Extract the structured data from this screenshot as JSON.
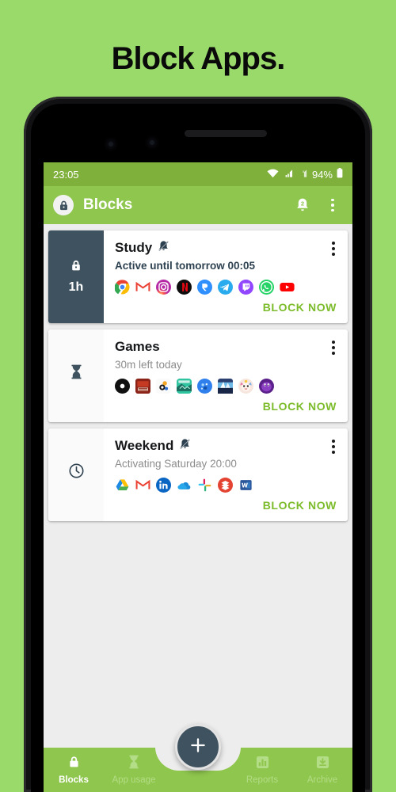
{
  "headline": "Block Apps.",
  "status_bar": {
    "time": "23:05",
    "battery": "94%",
    "icons": [
      "wifi-icon",
      "signal-icon",
      "signal-no-sim-icon",
      "battery-icon"
    ]
  },
  "app_bar": {
    "logo_icon": "lock-badge-icon",
    "title": "Blocks",
    "notification_icon": "bell-icon",
    "notification_count": "2",
    "overflow_icon": "overflow-menu-icon"
  },
  "cards": [
    {
      "side_icon": "lock-icon",
      "side_duration": "1h",
      "side_style": "dark",
      "title": "Study",
      "mute_icon": "bell-muted-icon",
      "muted": true,
      "subtitle": "Active until tomorrow 00:05",
      "subtitle_state": "active",
      "action_label": "BLOCK NOW",
      "apps": [
        {
          "name": "chrome",
          "color": "#4285f4"
        },
        {
          "name": "gmail",
          "color": "#ea4335"
        },
        {
          "name": "instagram",
          "color": "#e1306c"
        },
        {
          "name": "netflix",
          "color": "#e50914"
        },
        {
          "name": "revolut",
          "color": "#0075eb"
        },
        {
          "name": "telegram",
          "color": "#2aabee"
        },
        {
          "name": "twitch",
          "color": "#9146ff"
        },
        {
          "name": "whatsapp",
          "color": "#25d366"
        },
        {
          "name": "youtube",
          "color": "#ff0000"
        }
      ]
    },
    {
      "side_icon": "hourglass-icon",
      "side_duration": "",
      "side_style": "light",
      "title": "Games",
      "mute_icon": "",
      "muted": false,
      "subtitle": "30m left today",
      "subtitle_state": "muted",
      "action_label": "BLOCK NOW",
      "apps": [
        {
          "name": "game-dot",
          "color": "#111111"
        },
        {
          "name": "game-red",
          "color": "#8b2319"
        },
        {
          "name": "game-white",
          "color": "#f5a623"
        },
        {
          "name": "game-teal",
          "color": "#2ec4a0"
        },
        {
          "name": "game-blue",
          "color": "#2f80ed"
        },
        {
          "name": "game-navy",
          "color": "#2b3f70"
        },
        {
          "name": "game-pink",
          "color": "#f3c3d2"
        },
        {
          "name": "game-purple",
          "color": "#7b2ea8"
        }
      ]
    },
    {
      "side_icon": "clock-icon",
      "side_duration": "",
      "side_style": "light",
      "title": "Weekend",
      "mute_icon": "bell-muted-icon",
      "muted": true,
      "subtitle": "Activating Saturday 20:00",
      "subtitle_state": "muted",
      "action_label": "BLOCK NOW",
      "apps": [
        {
          "name": "google-drive",
          "color": "#0da960"
        },
        {
          "name": "gmail",
          "color": "#ea4335"
        },
        {
          "name": "linkedin",
          "color": "#0a66c2"
        },
        {
          "name": "onedrive",
          "color": "#0f78d4"
        },
        {
          "name": "slack",
          "color": "#e01e5a"
        },
        {
          "name": "todoist",
          "color": "#e44332"
        },
        {
          "name": "ms-word",
          "color": "#2b579a"
        }
      ]
    }
  ],
  "fab": {
    "icon": "plus-icon",
    "label": "+"
  },
  "bottom_nav": {
    "items": [
      {
        "label": "Blocks",
        "icon": "lock-icon",
        "active": true
      },
      {
        "label": "App usage",
        "icon": "hourglass-icon",
        "active": false
      },
      {
        "label": "Reports",
        "icon": "bar-chart-icon",
        "active": false
      },
      {
        "label": "Archive",
        "icon": "archive-icon",
        "active": false
      }
    ]
  },
  "colors": {
    "page_background": "#9ada6b",
    "app_bar": "#8fc64e",
    "status_bar": "#7fb03c",
    "accent_green": "#7cbb2a",
    "dark_slate": "#3f5260",
    "screen_background": "#ededed"
  }
}
